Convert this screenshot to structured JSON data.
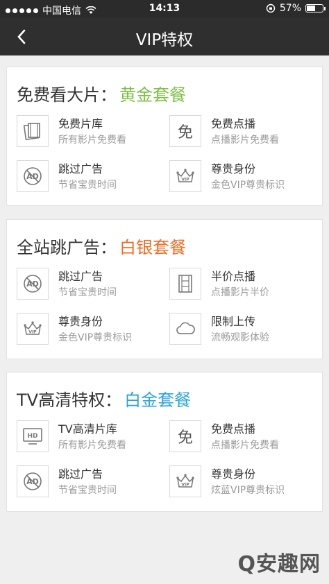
{
  "status_bar": {
    "carrier": "中国电信",
    "time": "14:13",
    "battery": "57%",
    "battery_level": 0.57
  },
  "nav": {
    "title": "VIP特权"
  },
  "colors": {
    "gold": "#7ac142",
    "silver": "#f26b21",
    "platinum": "#29a3dd"
  },
  "cards": [
    {
      "prefix": "免费看大片：",
      "package": "黄金套餐",
      "features": [
        {
          "icon": "film-library-icon",
          "title": "免费片库",
          "subtitle": "所有影片免费看"
        },
        {
          "icon": "free-icon",
          "glyph": "免",
          "title": "免费点播",
          "subtitle": "点播影片免费看"
        },
        {
          "icon": "no-ad-icon",
          "title": "跳过广告",
          "subtitle": "节省宝贵时间"
        },
        {
          "icon": "vip-crown-icon",
          "title": "尊贵身份",
          "subtitle": "金色VIP尊贵标识"
        }
      ]
    },
    {
      "prefix": "全站跳广告：",
      "package": "白银套餐",
      "features": [
        {
          "icon": "no-ad-icon",
          "title": "跳过广告",
          "subtitle": "节省宝贵时间"
        },
        {
          "icon": "film-strip-icon",
          "title": "半价点播",
          "subtitle": "点播影片半价"
        },
        {
          "icon": "vip-crown-icon",
          "title": "尊贵身份",
          "subtitle": "金色VIP尊贵标识"
        },
        {
          "icon": "cloud-icon",
          "title": "限制上传",
          "subtitle": "流畅观影体验"
        }
      ]
    },
    {
      "prefix": "TV高清特权：",
      "package": "白金套餐",
      "features": [
        {
          "icon": "hd-tv-icon",
          "title": "TV高清片库",
          "subtitle": "所有影片免费看"
        },
        {
          "icon": "free-icon",
          "glyph": "免",
          "title": "免费点播",
          "subtitle": "点播影片免费看"
        },
        {
          "icon": "no-ad-icon",
          "title": "跳过广告",
          "subtitle": "节省宝贵时间"
        },
        {
          "icon": "vip-crown-icon",
          "title": "尊贵身份",
          "subtitle": "炫蓝VIP尊贵标识"
        }
      ]
    }
  ],
  "watermark": "Q安趣网"
}
